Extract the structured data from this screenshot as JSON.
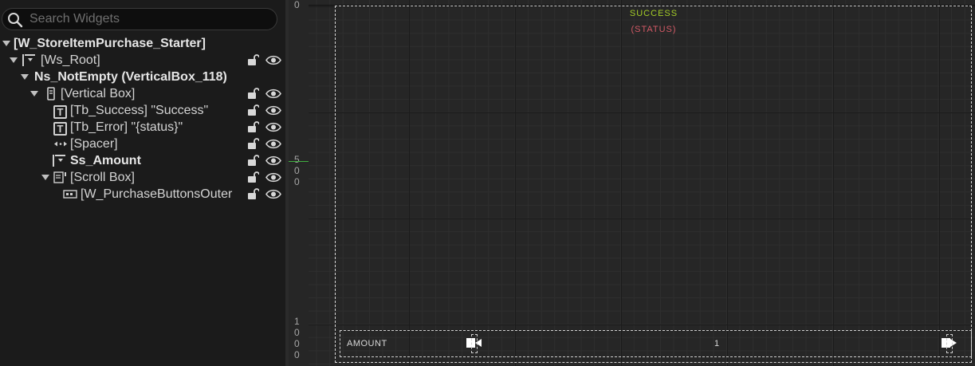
{
  "search": {
    "placeholder": "Search Widgets"
  },
  "hierarchy": {
    "root_label": "[W_StoreItemPurchase_Starter]",
    "items": [
      {
        "label": "[Ws_Root]",
        "icon": "widget-switcher-icon"
      },
      {
        "label": "Ns_NotEmpty (VerticalBox_118)",
        "icon": "none"
      },
      {
        "label": "[Vertical Box]",
        "icon": "vertical-box-icon"
      },
      {
        "label": "[Tb_Success] \"Success\"",
        "icon": "text-block-icon"
      },
      {
        "label": "[Tb_Error] \"{status}\"",
        "icon": "text-block-icon"
      },
      {
        "label": "[Spacer]",
        "icon": "spacer-icon"
      },
      {
        "label": "Ss_Amount",
        "icon": "spin-box-icon"
      },
      {
        "label": "[Scroll Box]",
        "icon": "scroll-box-icon"
      },
      {
        "label": "[W_PurchaseButtonsOuter",
        "icon": "user-widget-icon"
      }
    ]
  },
  "ruler": {
    "ticks": [
      {
        "label": "0"
      },
      {
        "label": "5"
      },
      {
        "label": "0"
      },
      {
        "label": "0"
      },
      {
        "label": "1"
      },
      {
        "label": "0"
      },
      {
        "label": "0"
      },
      {
        "label": "0"
      }
    ]
  },
  "canvas": {
    "success_text": "SUCCESS",
    "status_text": "(STATUS)",
    "amount_label": "AMOUNT",
    "amount_value": "1"
  },
  "colors": {
    "success": "#a4cc26",
    "status": "#d45a66",
    "guide": "#3fae3f"
  }
}
